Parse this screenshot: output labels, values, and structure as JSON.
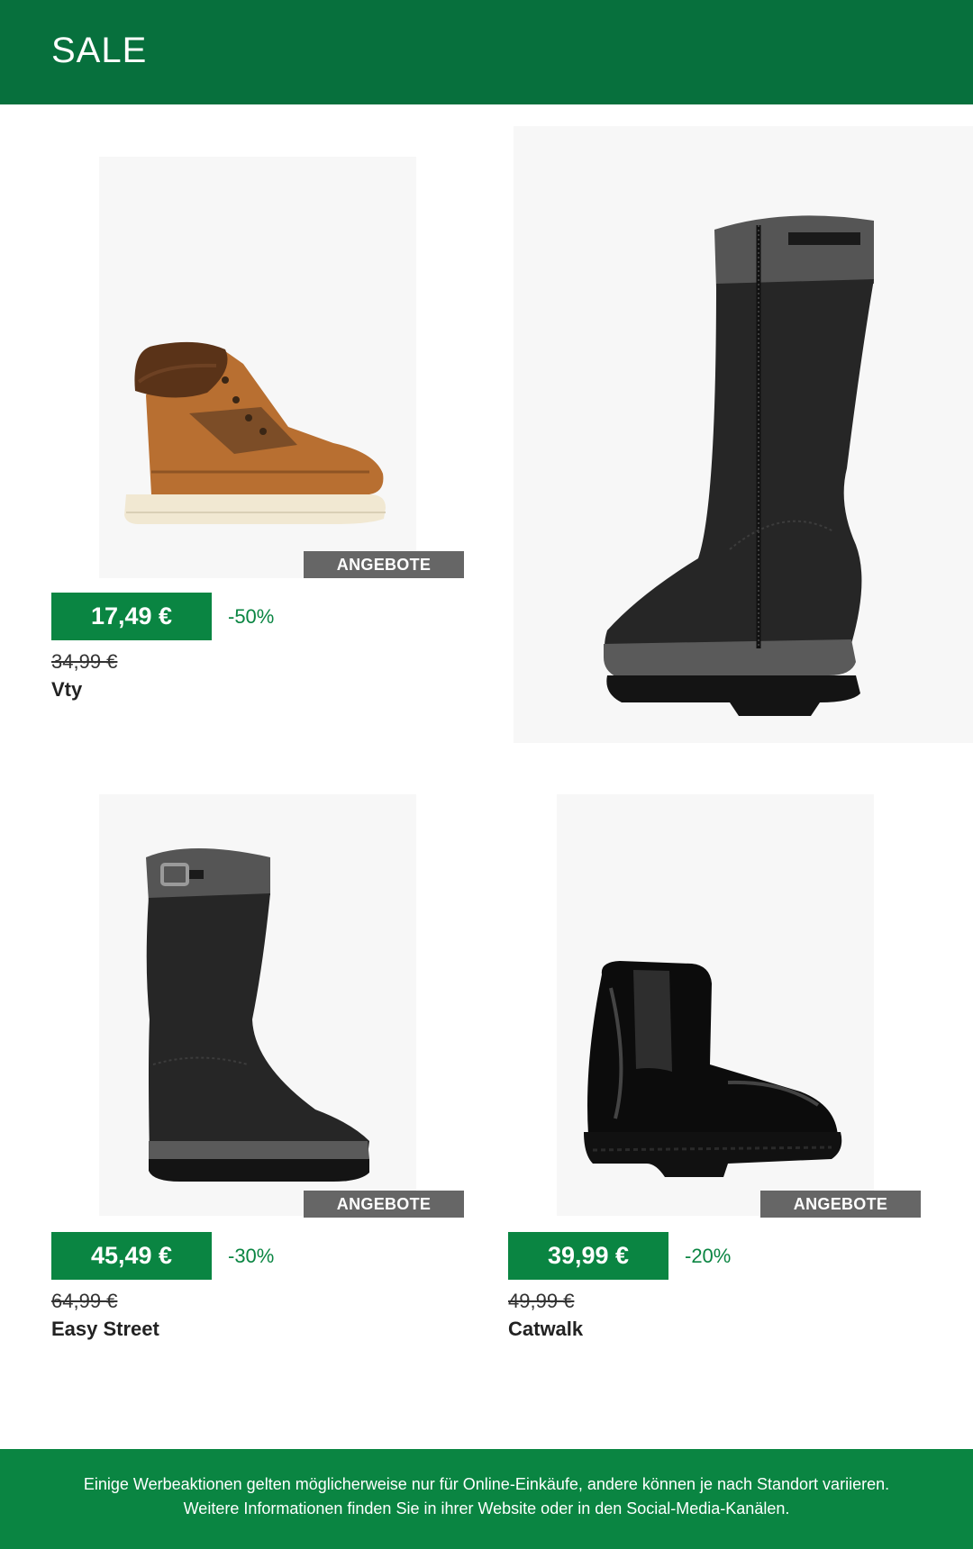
{
  "header": {
    "title": "SALE"
  },
  "products": [
    {
      "badge": "ANGEBOTE",
      "price": "17,49 €",
      "discount": "-50%",
      "old_price": "34,99 €",
      "brand": "Vty",
      "image_icon": "brown-lace-up-fur-boot-icon"
    },
    {
      "image_icon": "black-tall-zip-boot-icon"
    },
    {
      "badge": "ANGEBOTE",
      "price": "45,49 €",
      "discount": "-30%",
      "old_price": "64,99 €",
      "brand": "Easy Street",
      "image_icon": "black-slouch-boot-buckle-icon"
    },
    {
      "badge": "ANGEBOTE",
      "price": "39,99 €",
      "discount": "-20%",
      "old_price": "49,99 €",
      "brand": "Catwalk",
      "image_icon": "black-patent-chelsea-boot-icon"
    }
  ],
  "footer": {
    "disclaimer": "Einige Werbeaktionen gelten möglicherweise nur für Online-Einkäufe, andere können je nach Standort variieren. Weitere Informationen finden Sie in ihrer Website oder in den Social-Media-Kanälen."
  },
  "colors": {
    "header_green": "#07703d",
    "accent_green": "#0a8542",
    "badge_gray": "#666666"
  }
}
